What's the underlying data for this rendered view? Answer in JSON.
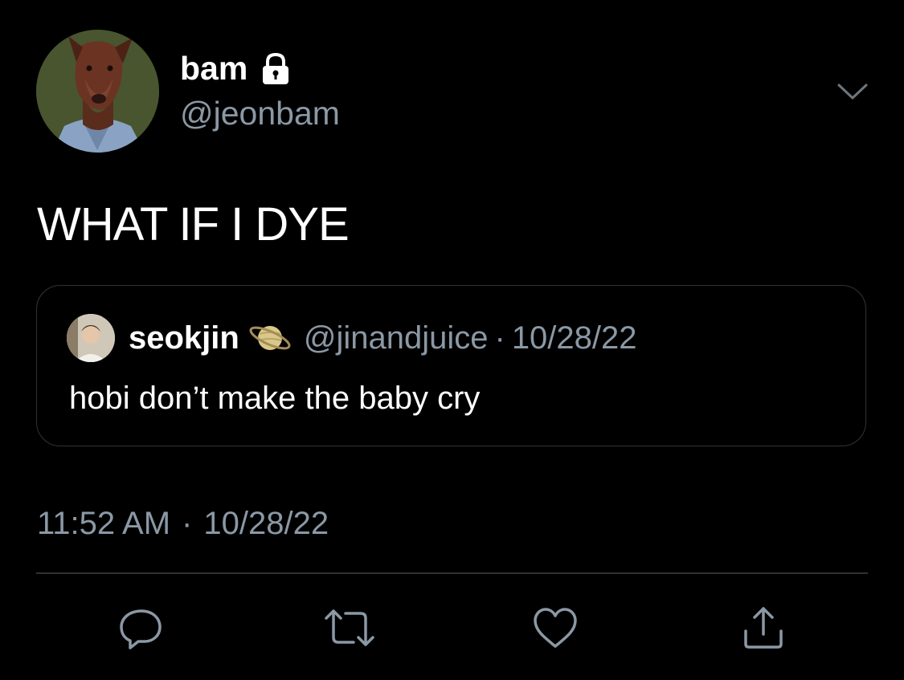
{
  "tweet": {
    "author": {
      "display_name": "bam",
      "handle": "@jeonbam",
      "avatar": "doberman-avatar",
      "protected_icon": "lock-icon"
    },
    "menu_icon": "chevron-down-icon",
    "text": "WHAT IF I DYE",
    "quoted": {
      "display_name": "seokjin",
      "badge_icon": "planet-icon",
      "handle": "@jinandjuice",
      "separator": "·",
      "date": "10/28/22",
      "text": "hobi don’t make the baby cry"
    },
    "time": "11:52 AM",
    "separator": "·",
    "date": "10/28/22",
    "actions": [
      {
        "name": "reply",
        "icon": "reply-icon"
      },
      {
        "name": "retweet",
        "icon": "retweet-icon"
      },
      {
        "name": "like",
        "icon": "heart-icon"
      },
      {
        "name": "share",
        "icon": "share-icon"
      }
    ]
  },
  "colors": {
    "background": "#000000",
    "text_primary": "#ffffff",
    "text_secondary": "#8b98a5",
    "border": "#2f3336"
  }
}
